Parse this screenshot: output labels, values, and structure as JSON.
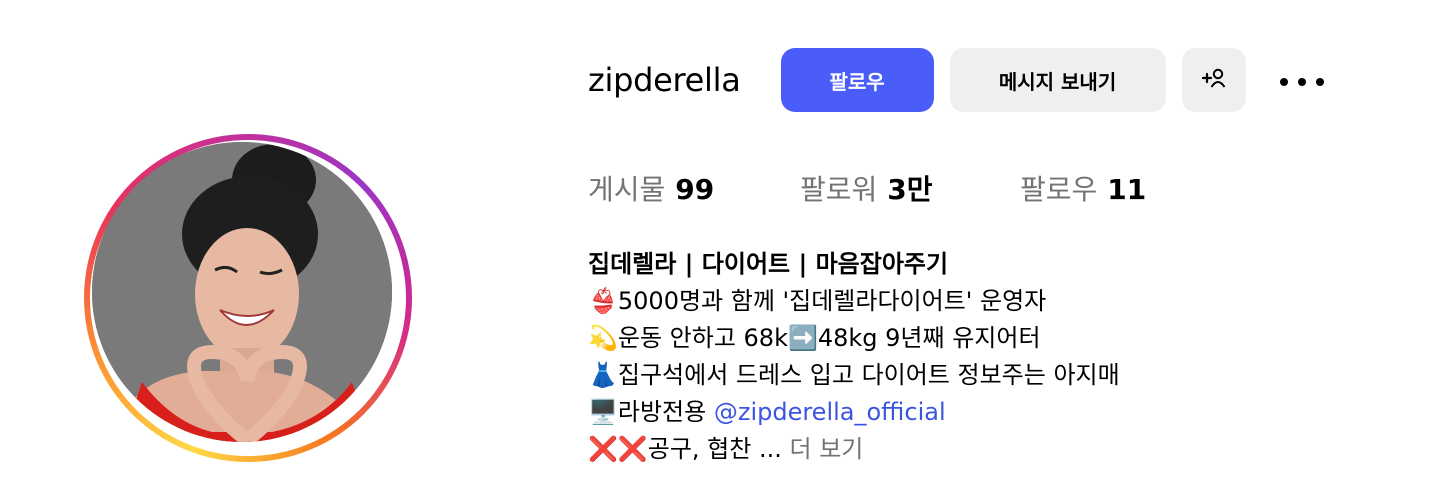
{
  "profile": {
    "username": "zipderella",
    "follow_label": "팔로우",
    "message_label": "메시지 보내기",
    "add_label": "+ዖ"
  },
  "stats": {
    "posts_label": "게시물",
    "posts_value": "99",
    "followers_label": "팔로워",
    "followers_value": "3만",
    "following_label": "팔로우",
    "following_value": "11"
  },
  "bio": {
    "name": "집데렐라 | 다이어트 | 마음잡아주기",
    "line1": "👙5000명과 함께 '집데렐라다이어트' 운영자",
    "line2": "💫운동 안하고 68k➡️48kg 9년째 유지어터",
    "line3": "👗집구석에서 드레스 입고 다이어트 정보주는 아지매",
    "line4_prefix": "🖥️라방전용 ",
    "line4_link": "@zipderella_official",
    "line5_text": "❌❌공구, 협찬 ... ",
    "line5_more": "더 보기"
  },
  "colors": {
    "follow_button": "#4a5df9",
    "secondary_button": "#efefef",
    "link": "#3c55e0",
    "muted_text": "#737373"
  },
  "icons": [
    "more-icon",
    "add-person-icon"
  ]
}
